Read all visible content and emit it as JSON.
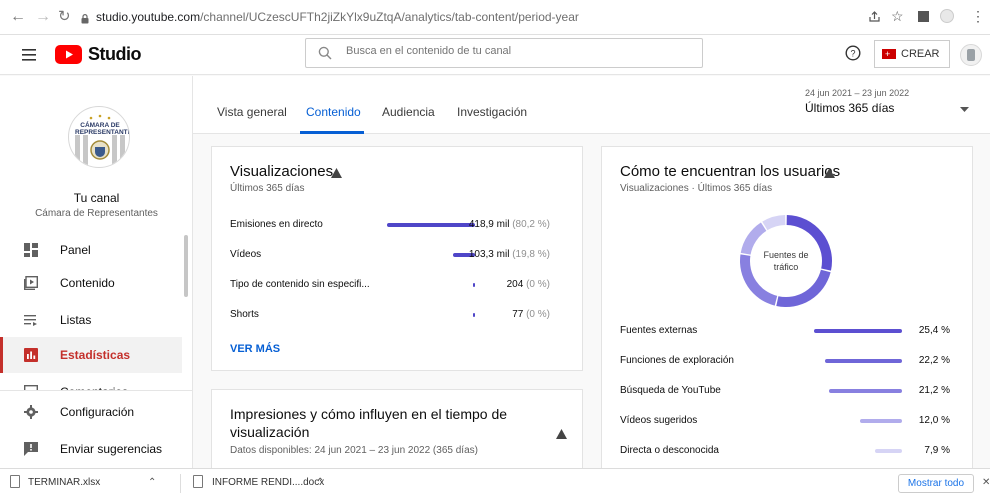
{
  "browser": {
    "url_host": "studio.youtube.com",
    "url_path": "/channel/UCzescUFTh2jiZkYlx9uZtqA/analytics/tab-content/period-year"
  },
  "header": {
    "logo_text": "Studio",
    "search_placeholder": "Busca en el contenido de tu canal",
    "create_label": "CREAR"
  },
  "channel": {
    "logo_text": "CÁMARA DE REPRESENTANTES",
    "title": "Tu canal",
    "name": "Cámara de Representantes"
  },
  "sidebar": {
    "items": [
      {
        "label": "Panel",
        "icon": "dashboard-icon"
      },
      {
        "label": "Contenido",
        "icon": "content-icon"
      },
      {
        "label": "Listas",
        "icon": "playlist-icon"
      },
      {
        "label": "Estadísticas",
        "icon": "analytics-icon",
        "active": true
      },
      {
        "label": "Comentarios",
        "icon": "comments-icon"
      },
      {
        "label": "Configuración",
        "icon": "gear-icon"
      },
      {
        "label": "Enviar sugerencias",
        "icon": "feedback-icon"
      }
    ]
  },
  "tabs": [
    "Vista general",
    "Contenido",
    "Audiencia",
    "Investigación"
  ],
  "active_tab": "Contenido",
  "date_range": {
    "range": "24 jun 2021 – 23 jun 2022",
    "label": "Últimos 365 días"
  },
  "views_card": {
    "title": "Visualizaciones",
    "subtitle": "Últimos 365 días",
    "rows": [
      {
        "label": "Emisiones en directo",
        "value": "418,9 mil",
        "pct": "(80,2 %)",
        "fraction": 0.802
      },
      {
        "label": "Vídeos",
        "value": "103,3 mil",
        "pct": "(19,8 %)",
        "fraction": 0.198
      },
      {
        "label": "Tipo de contenido sin especifi...",
        "value": "204",
        "pct": "(0 %)",
        "fraction": 0.0
      },
      {
        "label": "Shorts",
        "value": "77",
        "pct": "(0 %)",
        "fraction": 0.0
      }
    ],
    "more_label": "VER MÁS"
  },
  "impressions_card": {
    "title_line1": "Impresiones y cómo influyen en el tiempo de",
    "title_line2": "visualización",
    "subtitle": "Datos disponibles: 24 jun 2021 – 23 jun 2022 (365 días)"
  },
  "traffic_card": {
    "title": "Cómo te encuentran los usuarios",
    "subtitle": "Visualizaciones · Últimos 365 días",
    "donut_label_line1": "Fuentes de",
    "donut_label_line2": "tráfico",
    "rows": [
      {
        "label": "Fuentes externas",
        "value": "25,4 %",
        "fraction": 0.254,
        "color": "#5c4fd1"
      },
      {
        "label": "Funciones de exploración",
        "value": "22,2 %",
        "fraction": 0.222,
        "color": "#6f66d8"
      },
      {
        "label": "Búsqueda de YouTube",
        "value": "21,2 %",
        "fraction": 0.212,
        "color": "#8880e0"
      },
      {
        "label": "Vídeos sugeridos",
        "value": "12,0 %",
        "fraction": 0.12,
        "color": "#b1acec"
      },
      {
        "label": "Directa o desconocida",
        "value": "7,9 %",
        "fraction": 0.079,
        "color": "#d6d4f5"
      }
    ]
  },
  "downloads": {
    "items": [
      "TERMINAR.xlsx",
      "INFORME RENDI....docx"
    ],
    "show_all": "Mostrar todo"
  },
  "colors": {
    "accent": "#065fd4",
    "active_red": "#c4302b",
    "bar_primary": "#4f46c8"
  }
}
